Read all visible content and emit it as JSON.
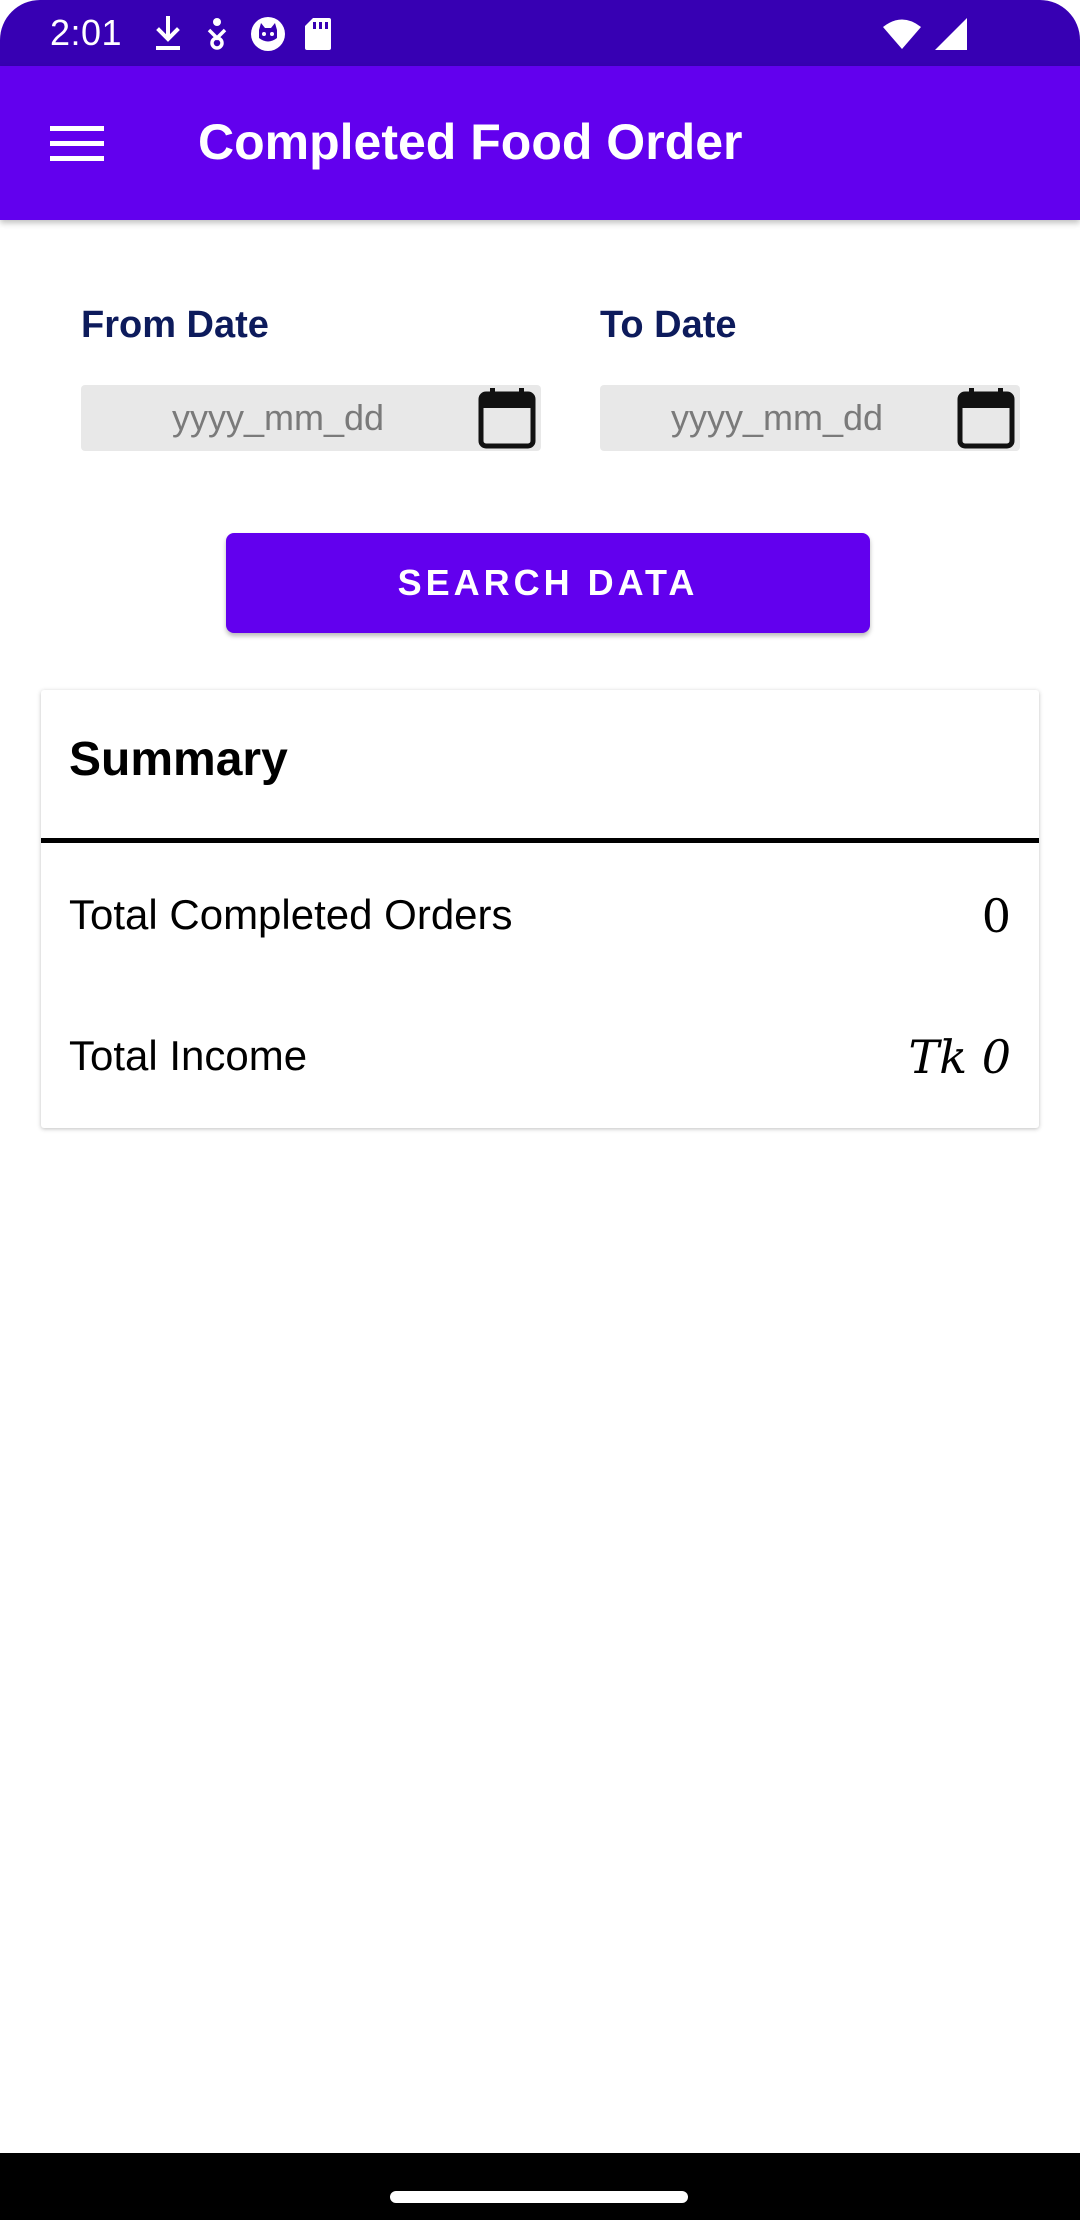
{
  "status_bar": {
    "time": "2:01",
    "icons_left": [
      "download-icon",
      "accessibility-icon",
      "cat-face-icon",
      "sd-card-icon"
    ],
    "icons_right": [
      "wifi-icon",
      "cell-signal-icon"
    ]
  },
  "app_bar": {
    "title": "Completed Food Order",
    "menu_icon": "hamburger-menu-icon",
    "background": "#6200EE"
  },
  "filters": {
    "from_label": "From Date",
    "to_label": "To Date",
    "from_placeholder": "yyyy_mm_dd",
    "to_placeholder": "yyyy_mm_dd",
    "from_value": "",
    "to_value": "",
    "calendar_icon": "calendar-icon"
  },
  "search_button": {
    "label": "SEARCH DATA"
  },
  "summary": {
    "title": "Summary",
    "rows": [
      {
        "label": "Total Completed Orders",
        "value": "0"
      },
      {
        "label": "Total Income",
        "value": "Tk 0"
      }
    ]
  },
  "colors": {
    "status_bar": "#3700B3",
    "primary": "#6200EE",
    "label_text": "#0D1B5C",
    "field_background": "#E8E8E8"
  }
}
